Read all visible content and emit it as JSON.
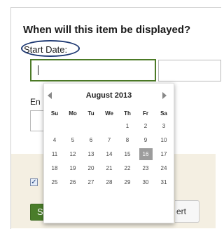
{
  "form": {
    "heading": "When will this item be displayed?",
    "start_date_label": "Start Date:",
    "start_date_value": "",
    "start_time_value": "",
    "end_label_partial": "En",
    "end_date_value": "",
    "checkbox_checked": true,
    "checkbox_mark": "✓",
    "save_button_partial": "S",
    "insert_button_partial": "ert"
  },
  "calendar": {
    "month_title": "August 2013",
    "weekdays": [
      "Su",
      "Mo",
      "Tu",
      "We",
      "Th",
      "Fr",
      "Sa"
    ],
    "weeks": [
      [
        "",
        "",
        "",
        "",
        "1",
        "2",
        "3"
      ],
      [
        "4",
        "5",
        "6",
        "7",
        "8",
        "9",
        "10"
      ],
      [
        "11",
        "12",
        "13",
        "14",
        "15",
        "16",
        "17"
      ],
      [
        "18",
        "19",
        "20",
        "21",
        "22",
        "23",
        "24"
      ],
      [
        "25",
        "26",
        "27",
        "28",
        "29",
        "30",
        "31"
      ]
    ],
    "highlighted_day": "16",
    "highlight_color": "#9c9c9c"
  },
  "colors": {
    "accent_green": "#4a7d2a",
    "annotation_ellipse": "#1f3a73",
    "footer_background": "#f4efe2"
  }
}
